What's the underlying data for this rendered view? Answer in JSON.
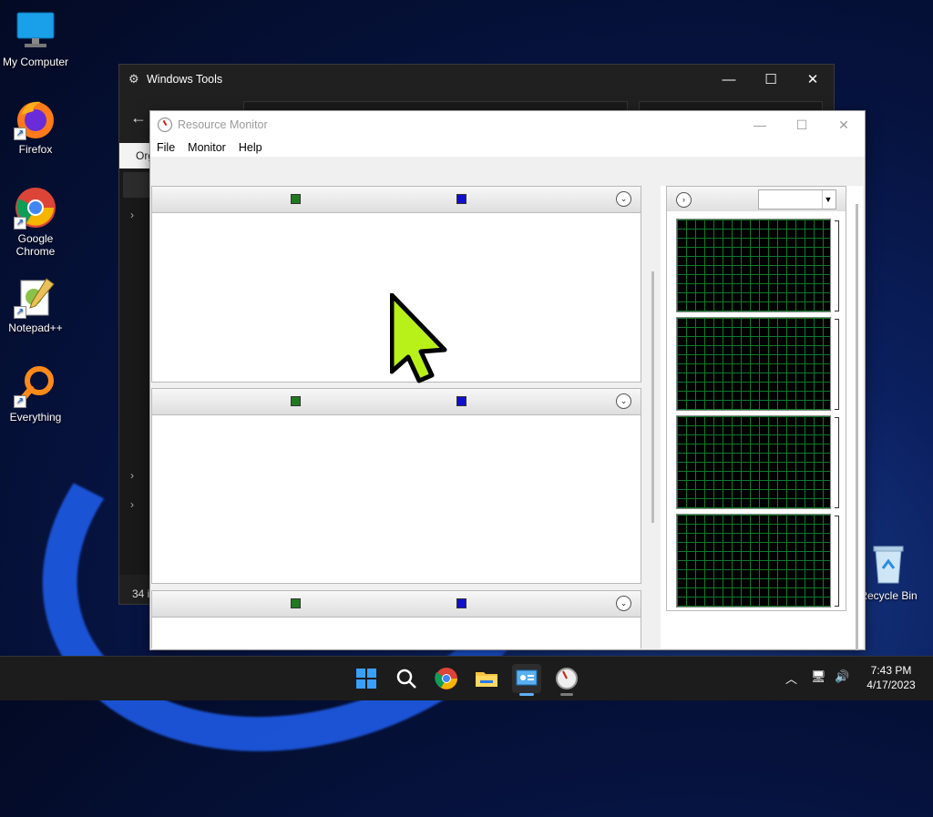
{
  "desktop": {
    "icons": [
      {
        "label": "My Computer"
      },
      {
        "label": "Firefox"
      },
      {
        "label": "Google Chrome"
      },
      {
        "label": "Notepad++"
      },
      {
        "label": "Everything"
      },
      {
        "label": "Recycle Bin"
      }
    ]
  },
  "windows_tools": {
    "title": "Windows Tools",
    "command_bar_label": "Org",
    "status_text": "34 i"
  },
  "resource_monitor": {
    "title": "Resource Monitor",
    "menu": [
      "File",
      "Monitor",
      "Help"
    ],
    "colors": {
      "series_green": "#1f7a1f",
      "series_blue": "#1010cc",
      "graph_grid": "#0e7a2a"
    }
  },
  "taskbar": {
    "time": "7:43 PM",
    "date": "4/17/2023",
    "pinned": [
      "start",
      "search",
      "chrome",
      "file-explorer",
      "windows-tools",
      "resource-monitor"
    ]
  }
}
